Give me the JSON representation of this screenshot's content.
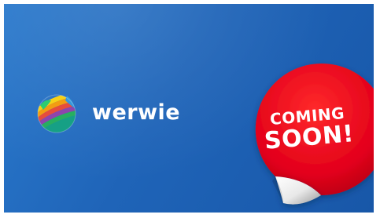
{
  "brand": {
    "name": "werwie",
    "logo_icon": "striped-globe-icon"
  },
  "sticker": {
    "line1": "COMING",
    "line2": "SOON!",
    "icon": "peeling-sticker"
  },
  "colors": {
    "background": "#1f64b8",
    "sticker_red": "#e3001b",
    "text": "#ffffff"
  }
}
